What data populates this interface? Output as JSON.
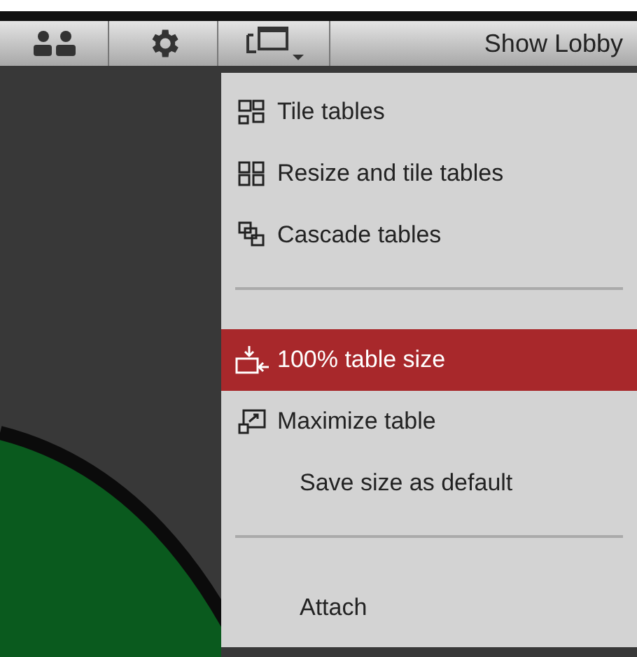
{
  "toolbar": {
    "buttons": [
      {
        "kind": "players"
      },
      {
        "kind": "settings"
      },
      {
        "kind": "layout"
      }
    ],
    "lobby_button": "Show Lobby"
  },
  "menu": {
    "items": [
      {
        "kind": "item",
        "label": "Tile tables",
        "selected": false
      },
      {
        "kind": "item",
        "label": "Resize and tile tables",
        "selected": false
      },
      {
        "kind": "item",
        "label": "Cascade tables",
        "selected": false
      },
      {
        "kind": "separator"
      },
      {
        "kind": "item",
        "label": "100% table size",
        "selected": true
      },
      {
        "kind": "item",
        "label": "Maximize table",
        "selected": false
      },
      {
        "kind": "item",
        "label": "Save size as default",
        "selected": false
      },
      {
        "kind": "separator"
      },
      {
        "kind": "item",
        "label": "Attach",
        "selected": false
      }
    ]
  }
}
